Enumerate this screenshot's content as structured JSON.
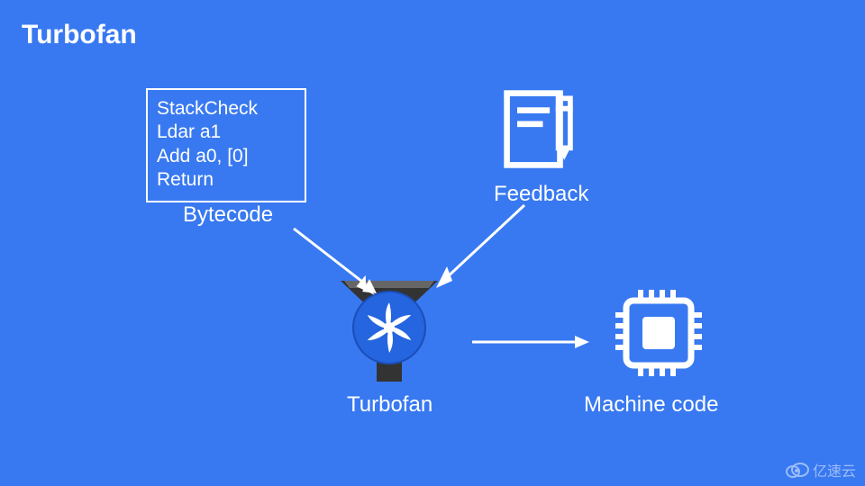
{
  "title": "Turbofan",
  "bytecode": {
    "lines": [
      "StackCheck",
      "Ldar a1",
      "Add a0, [0]",
      "Return"
    ],
    "label": "Bytecode"
  },
  "feedback": {
    "label": "Feedback"
  },
  "turbofan": {
    "label": "Turbofan"
  },
  "machine": {
    "label": "Machine code"
  },
  "watermark": {
    "text": "亿速云"
  },
  "colors": {
    "background": "#3879f1",
    "foreground": "#ffffff",
    "fan_blue": "#2565df",
    "fan_dark": "#333333"
  }
}
